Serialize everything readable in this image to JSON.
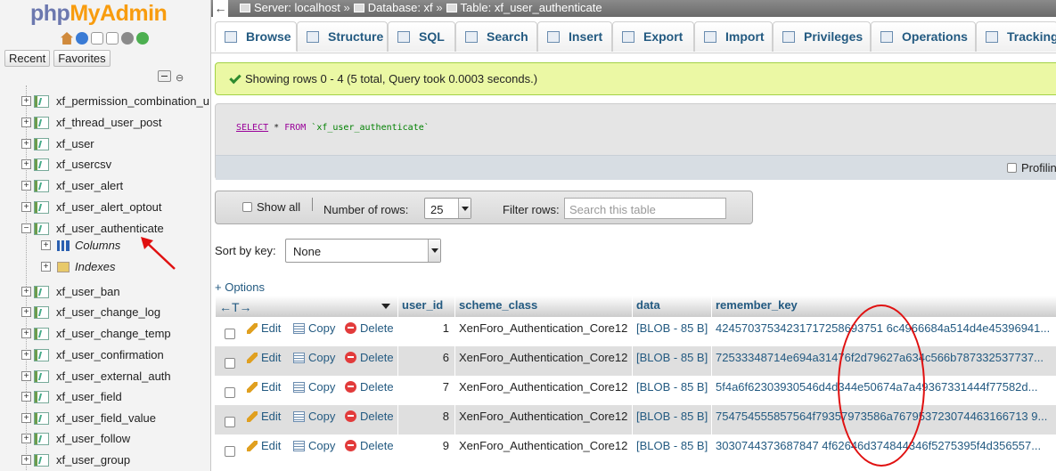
{
  "logo": {
    "part1": "php",
    "part2": "MyAdmin"
  },
  "nav": {
    "tabs": [
      "Recent",
      "Favorites"
    ],
    "tables": [
      "xf_permission_combination_u",
      "xf_thread_user_post",
      "xf_user",
      "xf_usercsv",
      "xf_user_alert",
      "xf_user_alert_optout",
      "xf_user_authenticate"
    ],
    "subitems": [
      "Columns",
      "Indexes"
    ],
    "tables_after": [
      "xf_user_ban",
      "xf_user_change_log",
      "xf_user_change_temp",
      "xf_user_confirmation",
      "xf_user_external_auth",
      "xf_user_field",
      "xf_user_field_value",
      "xf_user_follow",
      "xf_user_group"
    ]
  },
  "breadcrumb": {
    "server": "Server: localhost",
    "database": "Database: xf",
    "table": "Table: xf_user_authenticate",
    "sep": "»"
  },
  "tabs": [
    "Browse",
    "Structure",
    "SQL",
    "Search",
    "Insert",
    "Export",
    "Import",
    "Privileges",
    "Operations",
    "Tracking"
  ],
  "success_message": "Showing rows 0 - 4 (5 total, Query took 0.0003 seconds.)",
  "sql": {
    "kw1": "SELECT",
    "star": " * ",
    "kw2": "FROM",
    "table": " `xf_user_authenticate`"
  },
  "profiling_label": "Profiling",
  "navbar": {
    "show_all": "Show all",
    "number_of_rows_label": "Number of rows:",
    "number_of_rows_value": "25",
    "filter_rows_label": "Filter rows:",
    "filter_placeholder": "Search this table"
  },
  "sort": {
    "label": "Sort by key:",
    "value": "None"
  },
  "options_link": "+ Options",
  "table": {
    "arrows": "←T→",
    "columns": [
      "user_id",
      "scheme_class",
      "data",
      "remember_key"
    ],
    "actions": {
      "edit": "Edit",
      "copy": "Copy",
      "delete": "Delete"
    },
    "rows": [
      {
        "user_id": "1",
        "scheme_class": "XenForo_Authentication_Core12",
        "data": "[BLOB - 85 B]",
        "remember_key": "42457037534231717258693751 6c4966684a514d4e45396941..."
      },
      {
        "user_id": "6",
        "scheme_class": "XenForo_Authentication_Core12",
        "data": "[BLOB - 85 B]",
        "remember_key": "72533348714e694a31476f2d79627a634c566b787332537737..."
      },
      {
        "user_id": "7",
        "scheme_class": "XenForo_Authentication_Core12",
        "data": "[BLOB - 85 B]",
        "remember_key": "5f4a6f62303930546d4d344e50674a7a49367331444f77582d..."
      },
      {
        "user_id": "8",
        "scheme_class": "XenForo_Authentication_Core12",
        "data": "[BLOB - 85 B]",
        "remember_key": "754754555857564f79357973586a767953723074463166713 9..."
      },
      {
        "user_id": "9",
        "scheme_class": "XenForo_Authentication_Core12",
        "data": "[BLOB - 85 B]",
        "remember_key": "3030744373687847 4f62646d374844346f5275395f4d356557..."
      }
    ]
  },
  "colors": {
    "link": "#235a81",
    "success_bg": "#ebf8a4",
    "annotation": "#e01010"
  }
}
